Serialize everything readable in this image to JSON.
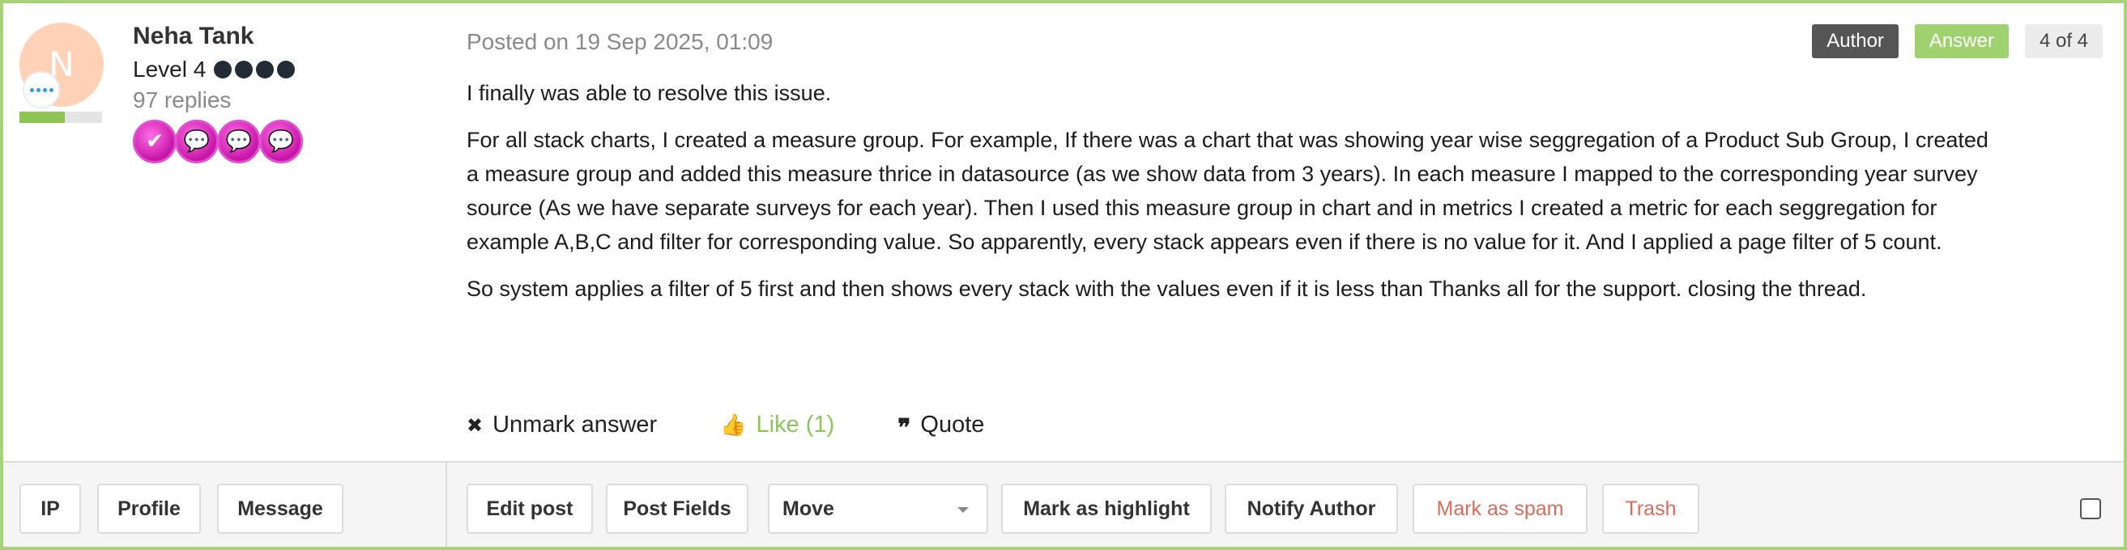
{
  "author": {
    "avatar_letter": "N",
    "name": "Neha Tank",
    "level_label": "Level 4",
    "level_dots": 4,
    "replies": "97 replies",
    "reputation_fraction": 0.55,
    "badges": [
      "check-badge",
      "chat-badge",
      "chat-badge",
      "chat-badge"
    ]
  },
  "post": {
    "posted_on": "Posted on 19 Sep 2025, 01:09",
    "tags": {
      "author": "Author",
      "answer": "Answer",
      "count": "4 of 4"
    },
    "paragraphs": [
      "I finally was able to resolve this issue.",
      "For all stack charts, I created a measure group. For example, If there was a chart that was showing year wise seggregation of a Product Sub Group, I created a measure group and added this measure thrice in datasource (as we show data from 3 years). In each measure I mapped to the corresponding year survey source (As we have separate surveys for each year). Then I used this measure group in chart and in metrics I created a metric for each seggregation for example A,B,C and filter for corresponding value. So apparently, every stack appears even if there is no value for it. And I applied a page filter of 5 count.",
      "So system applies a filter of 5 first and then shows every stack with the values even if it is less than Thanks all for the support. closing the thread."
    ],
    "actions": {
      "unmark": "Unmark answer",
      "like": "Like (1)",
      "quote": "Quote"
    }
  },
  "footer": {
    "left_buttons": [
      "IP",
      "Profile",
      "Message"
    ],
    "edit_post": "Edit post",
    "post_fields": "Post Fields",
    "move_value": "Move",
    "mark_highlight": "Mark as highlight",
    "notify_author": "Notify Author",
    "mark_spam": "Mark as spam",
    "trash": "Trash"
  },
  "colors": {
    "border_accent": "#a8d27a",
    "answer_tag": "#9fd26e",
    "author_tag": "#555555",
    "like": "#8cc55a",
    "danger": "#e06a5a",
    "badge": "#c715a8"
  }
}
